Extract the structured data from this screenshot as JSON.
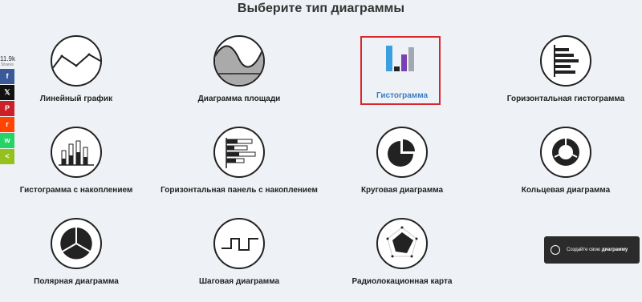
{
  "page": {
    "title": "Выберите тип диаграммы"
  },
  "share": {
    "count": "11.9k",
    "count_label": "Shares",
    "buttons": [
      {
        "icon": "facebook-icon",
        "glyph": "f",
        "color": "#3b5998"
      },
      {
        "icon": "x-twitter-icon",
        "glyph": "𝕏",
        "color": "#111111"
      },
      {
        "icon": "pinterest-icon",
        "glyph": "P",
        "color": "#cb2027"
      },
      {
        "icon": "reddit-icon",
        "glyph": "r",
        "color": "#ff4500"
      },
      {
        "icon": "whatsapp-icon",
        "glyph": "w",
        "color": "#25d366"
      },
      {
        "icon": "share-icon",
        "glyph": "<",
        "color": "#95c11f"
      }
    ]
  },
  "charts": [
    {
      "label": "Линейный график",
      "icon": "line-chart-icon"
    },
    {
      "label": "Диаграмма площади",
      "icon": "area-chart-icon"
    },
    {
      "label": "Гистограмма",
      "icon": "bar-chart-icon",
      "selected": true
    },
    {
      "label": "Горизонтальная гистограмма",
      "icon": "horizontal-bar-chart-icon"
    },
    {
      "label": "Гистограмма с накоплением",
      "icon": "stacked-bar-chart-icon"
    },
    {
      "label": "Горизонтальная панель с накоплением",
      "icon": "stacked-horizontal-bar-icon"
    },
    {
      "label": "Круговая диаграмма",
      "icon": "pie-chart-icon"
    },
    {
      "label": "Кольцевая диаграмма",
      "icon": "donut-chart-icon"
    },
    {
      "label": "Полярная диаграмма",
      "icon": "polar-chart-icon"
    },
    {
      "label": "Шаговая диаграмма",
      "icon": "step-chart-icon"
    },
    {
      "label": "Радиолокационная карта",
      "icon": "radar-chart-icon"
    }
  ],
  "create_button": {
    "prefix": "Создайте свою ",
    "bold": "диаграмму"
  },
  "colors": {
    "accent": "#3a7fc1",
    "selection": "#d9262c",
    "bar_blue": "#3b9ede",
    "bar_purple": "#7a3fb0",
    "bar_gray": "#a0a8b0"
  }
}
